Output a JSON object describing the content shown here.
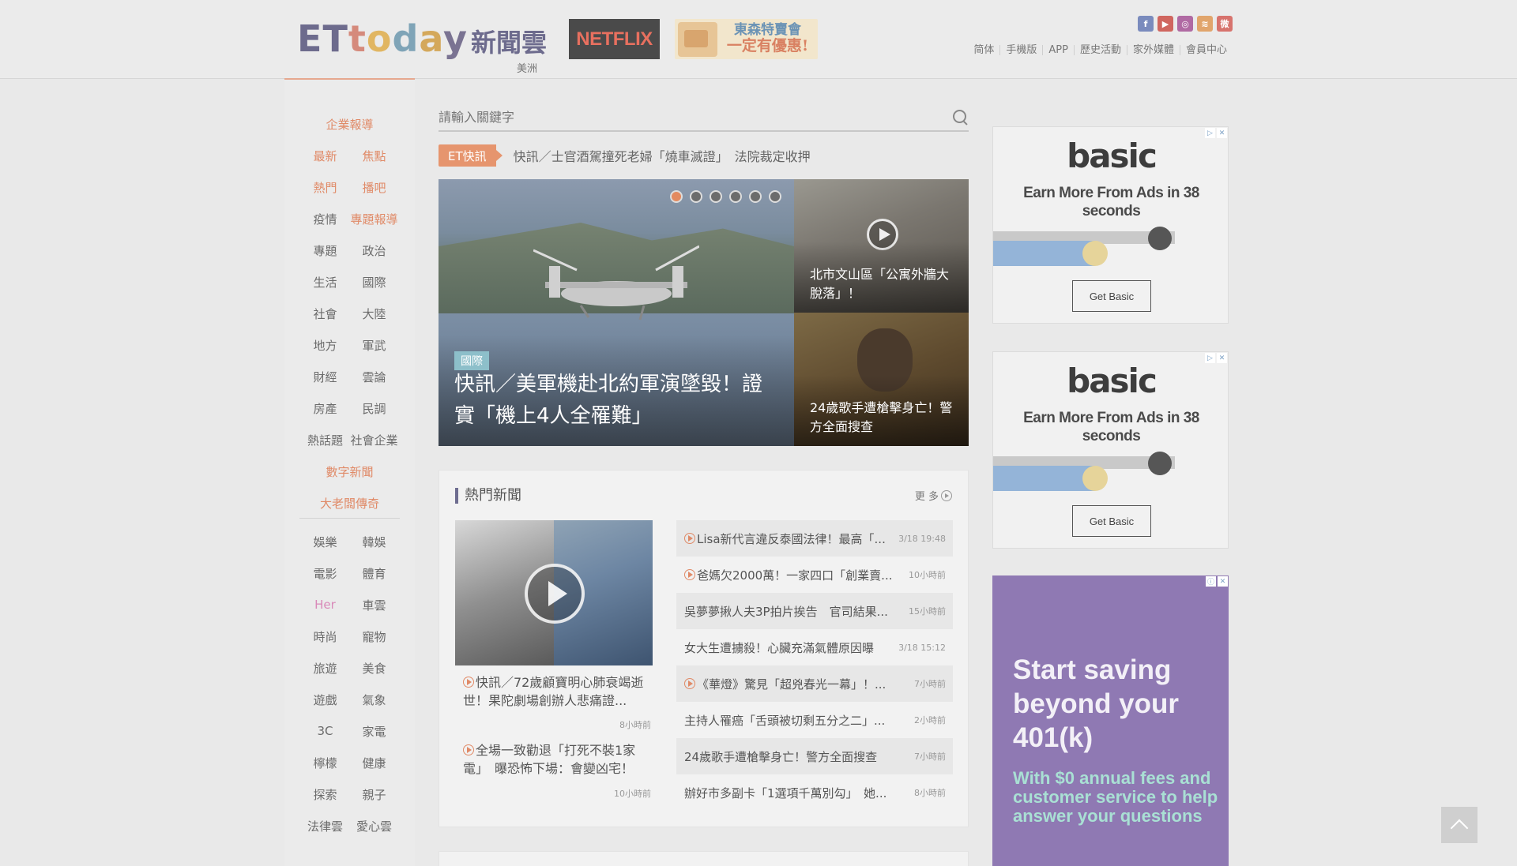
{
  "header": {
    "logo_latin": [
      "E",
      "T",
      "t",
      "o",
      "d",
      "a",
      "y"
    ],
    "logo_cn": "新聞雲",
    "region": "美洲",
    "netflix_label": "NETFLIX",
    "promo_line1": "東森特賣會",
    "promo_line2": "一定有優惠!",
    "social_icons": [
      "facebook-icon",
      "youtube-icon",
      "instagram-icon",
      "rss-icon",
      "weibo-icon"
    ],
    "social_glyphs": [
      "f",
      "▶",
      "◎",
      "≋",
      "微"
    ],
    "social_colors": [
      "#7a8bbd",
      "#d0665f",
      "#b06aa3",
      "#e1a56c",
      "#d7736d"
    ],
    "topnav": [
      "简体",
      "手機版",
      "APP",
      "歷史活動",
      "家外媒體",
      "會員中心"
    ]
  },
  "sidebar": {
    "group1": [
      [
        "企業報導"
      ],
      [
        "最新",
        "焦點"
      ],
      [
        "熱門",
        "播吧"
      ],
      [
        "疫情",
        "專題報導"
      ],
      [
        "專題",
        "政治"
      ],
      [
        "生活",
        "國際"
      ],
      [
        "社會",
        "大陸"
      ],
      [
        "地方",
        "軍武"
      ],
      [
        "財經",
        "雲論"
      ],
      [
        "房產",
        "民調"
      ],
      [
        "熱話題",
        "社會企業"
      ],
      [
        "數字新聞"
      ],
      [
        "大老闆傳奇"
      ]
    ],
    "group2": [
      [
        "娛樂",
        "韓娛"
      ],
      [
        "電影",
        "體育"
      ],
      [
        "Her",
        "車雲"
      ],
      [
        "時尚",
        "寵物"
      ],
      [
        "旅遊",
        "美食"
      ],
      [
        "遊戲",
        "氣象"
      ],
      [
        "3C",
        "家電"
      ],
      [
        "檸檬",
        "健康"
      ],
      [
        "探索",
        "親子"
      ],
      [
        "法律雲",
        "愛心雲"
      ]
    ],
    "orange_items": [
      "企業報導",
      "最新",
      "焦點",
      "熱門",
      "播吧",
      "專題報導",
      "數字新聞",
      "大老闆傳奇"
    ],
    "pink_items": [
      "Her"
    ]
  },
  "search": {
    "placeholder": "請輸入關鍵字"
  },
  "flash": {
    "tag": "ET快訊",
    "text": "快訊／士官酒駕撞死老婦「燒車滅證」　法院裁定收押"
  },
  "slider": {
    "active_dot": 1,
    "dot_count": 6,
    "main": {
      "category": "國際",
      "title": "快訊／美軍機赴北約軍演墜毀！證實「機上4人全罹難」"
    },
    "side": [
      {
        "title": "北市文山區「公寓外牆大脫落」！",
        "video": true
      },
      {
        "title": "24歲歌手遭槍擊身亡！警方全面搜查",
        "video": false
      }
    ]
  },
  "hot_news": {
    "title": "熱門新聞",
    "more": "更 多",
    "left_stories": [
      {
        "text": "快訊／72歲顧寶明心肺衰竭逝世！果陀劇場創辦人悲痛證...",
        "time": "8小時前",
        "video": true
      },
      {
        "text": "全場一致勸退「打死不裝1家電」　曝恐怖下場：會變凶宅！",
        "time": "10小時前",
        "video": true
      }
    ],
    "list": [
      {
        "text": "Lisa新代言違反泰國法律！最高「...",
        "time": "3/18 19:48",
        "video": true
      },
      {
        "text": "爸媽欠2000萬！一家四口「創業賣...",
        "time": "10小時前",
        "video": true
      },
      {
        "text": "吳夢夢揪人夫3P拍片挨告　官司結果...",
        "time": "15小時前",
        "video": false
      },
      {
        "text": "女大生遭擄殺！心臟充滿氣體原因曝",
        "time": "3/18 15:12",
        "video": false
      },
      {
        "text": "《華燈》驚見「超兇春光一幕」！...",
        "time": "7小時前",
        "video": true
      },
      {
        "text": "主持人罹癌「舌頭被切剩五分之二」...",
        "time": "2小時前",
        "video": false
      },
      {
        "text": "24歲歌手遭槍擊身亡！警方全面搜查",
        "time": "7小時前",
        "video": false
      },
      {
        "text": "辦好市多副卡「1選項千萬別勾」　她...",
        "time": "8小時前",
        "video": false
      }
    ]
  },
  "ads": {
    "basic": {
      "brand": "basic",
      "headline": "Earn More From Ads in 38 seconds",
      "button": "Get Basic",
      "progress_fraction": 0.54
    },
    "savings": {
      "headline": "Start saving beyond your 401(k)",
      "subline": "With $0 annual fees and customer service to help answer your questions"
    }
  }
}
